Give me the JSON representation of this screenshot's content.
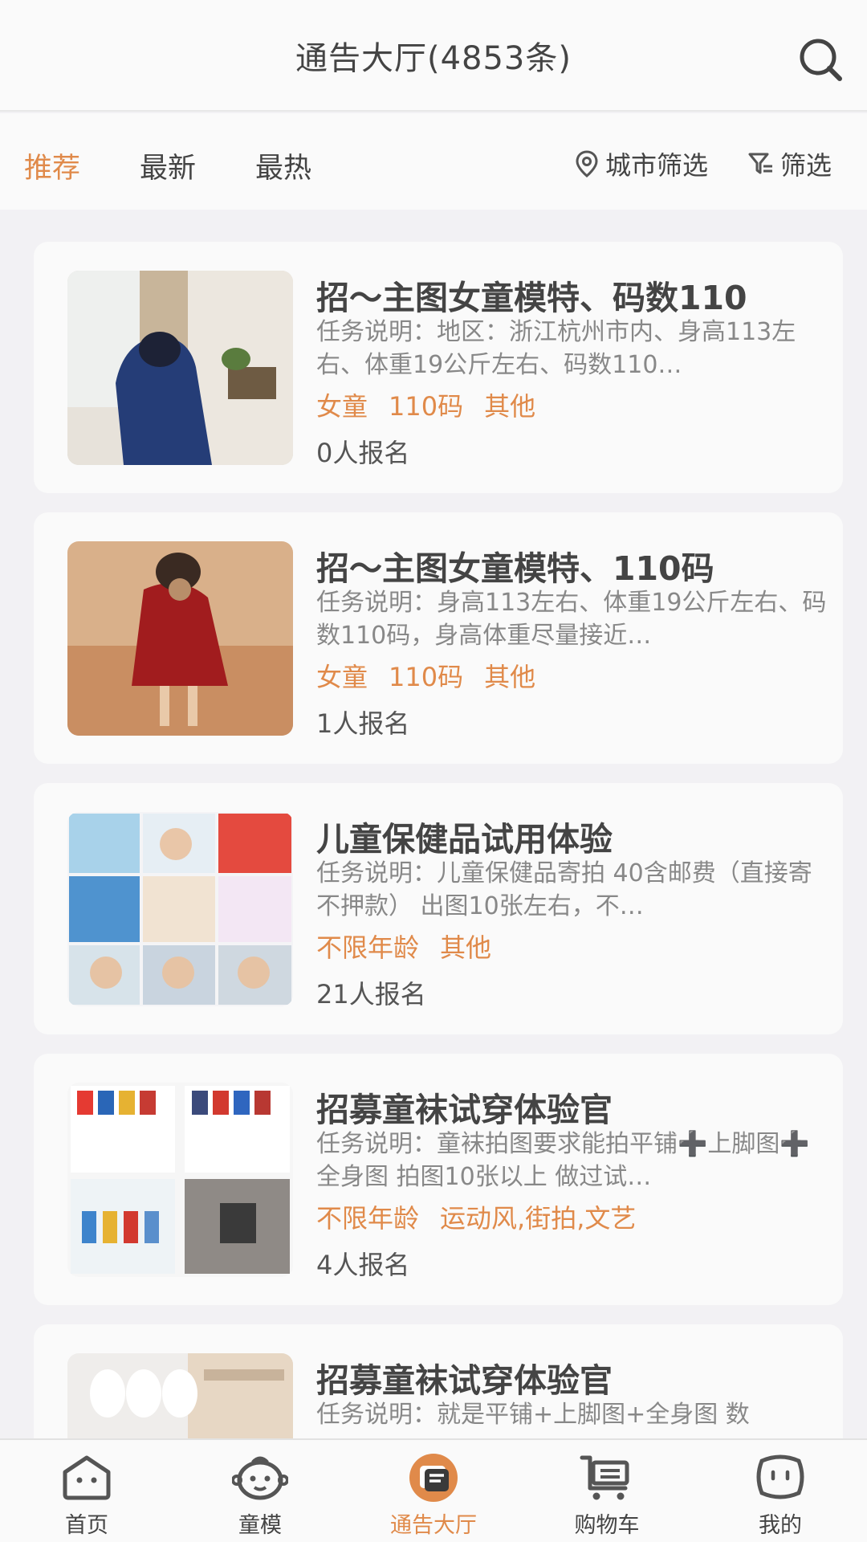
{
  "header": {
    "title": "通告大厅(4853条)"
  },
  "filters": {
    "tabs": [
      "推荐",
      "最新",
      "最热"
    ],
    "city_filter": "城市筛选",
    "filter": "筛选"
  },
  "cards": [
    {
      "title": "招～主图女童模特、码数110",
      "desc": "任务说明：地区：浙江杭州市内、身高113左右、体重19公斤左右、码数110…",
      "tags": [
        "女童",
        "110码",
        "其他"
      ],
      "count": "0人报名"
    },
    {
      "title": "招～主图女童模特、110码",
      "desc": "任务说明：身高113左右、体重19公斤左右、码数110码，身高体重尽量接近…",
      "tags": [
        "女童",
        "110码",
        "其他"
      ],
      "count": "1人报名"
    },
    {
      "title": "儿童保健品试用体验",
      "desc": "任务说明：儿童保健品寄拍 40含邮费（直接寄不押款） 出图10张左右，不…",
      "tags": [
        "不限年龄",
        "其他"
      ],
      "count": "21人报名"
    },
    {
      "title": "招募童袜试穿体验官",
      "desc": "任务说明：童袜拍图要求能拍平铺➕上脚图➕全身图 拍图10张以上 做过试…",
      "tags": [
        "不限年龄",
        "运动风,街拍,文艺"
      ],
      "count": "4人报名"
    },
    {
      "title": "招募童袜试穿体验官",
      "desc": "任务说明：就是平铺+上脚图+全身图 数",
      "tags": [],
      "count": ""
    }
  ],
  "tabbar": [
    {
      "label": "首页",
      "icon": "home-icon"
    },
    {
      "label": "童模",
      "icon": "baby-face-icon"
    },
    {
      "label": "通告大厅",
      "icon": "notice-hall-icon"
    },
    {
      "label": "购物车",
      "icon": "cart-icon"
    },
    {
      "label": "我的",
      "icon": "profile-icon"
    }
  ],
  "colors": {
    "accent": "#e08a4a",
    "background": "#f2f1f4",
    "card": "#fafafa"
  }
}
